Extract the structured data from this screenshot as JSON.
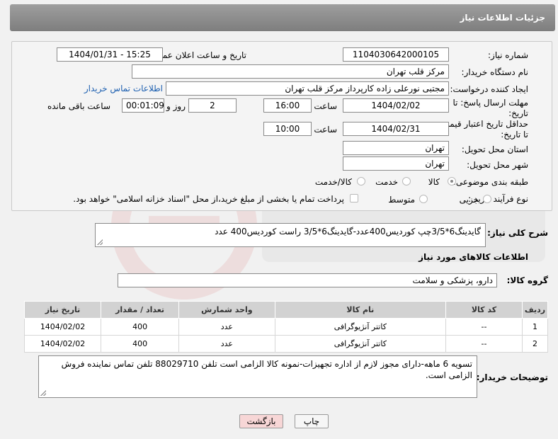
{
  "header": {
    "title": "جزئیات اطلاعات نیاز"
  },
  "form": {
    "need_number": {
      "label": "شماره نیاز:",
      "value": "1104030642000105"
    },
    "announce_datetime": {
      "label": "تاریخ و ساعت اعلان عمومی:",
      "value": "1404/01/31 - 15:25"
    },
    "buyer_org": {
      "label": "نام دستگاه خریدار:",
      "value": "مرکز قلب تهران"
    },
    "requester": {
      "label": "ایجاد کننده درخواست:",
      "value": "مجتبی نورعلی زاده کارپرداز مرکز قلب تهران",
      "contact_link": "اطلاعات تماس خریدار"
    },
    "deadline": {
      "label_line1": "مهلت ارسال پاسخ: تا",
      "label_line2": "تاریخ:",
      "date": "1404/02/02",
      "time_label": "ساعت",
      "time": "16:00",
      "days": "2",
      "days_label": "روز و",
      "remaining": "00:01:09",
      "remaining_label": "ساعت باقی مانده"
    },
    "price_validity": {
      "label_line1": "حداقل تاریخ اعتبار قیمت:",
      "label_line2": "تا تاریخ:",
      "date": "1404/02/31",
      "time_label": "ساعت",
      "time": "10:00"
    },
    "province": {
      "label": "استان محل تحویل:",
      "value": "تهران"
    },
    "city": {
      "label": "شهر محل تحویل:",
      "value": "تهران"
    },
    "category": {
      "label": "طبقه بندی موضوعی:",
      "options": [
        "کالا",
        "خدمت",
        "کالا/خدمت"
      ],
      "selected": "کالا"
    },
    "purchase_type": {
      "label": "نوع فرآیند خرید :",
      "options": [
        "جزیی",
        "متوسط"
      ],
      "note": "پرداخت تمام یا بخشی از مبلغ خرید،از محل \"اسناد خزانه اسلامی\" خواهد بود."
    }
  },
  "summary": {
    "label": "شرح کلی نیاز:",
    "value": "گایدینگ6*3/5چپ کوردیس400عدد-گایدینگ6*3/5 راست کوردیس400 عدد"
  },
  "goods_section": {
    "title": "اطلاعات کالاهای مورد نیاز",
    "group_label": "گروه کالا:",
    "group_value": "دارو، پزشکی و سلامت"
  },
  "table": {
    "headers": [
      "ردیف",
      "کد کالا",
      "نام کالا",
      "واحد شمارش",
      "تعداد / مقدار",
      "تاریخ نیاز"
    ],
    "rows": [
      [
        "1",
        "--",
        "کاتتر آنژیوگرافی",
        "عدد",
        "400",
        "1404/02/02"
      ],
      [
        "2",
        "--",
        "کاتتر آنژیوگرافی",
        "عدد",
        "400",
        "1404/02/02"
      ]
    ]
  },
  "buyer_notes": {
    "label": "توضیحات خریدار:",
    "value": "تسویه 6 ماهه-دارای مجوز لازم از اداره تجهیزات-نمونه کالا الزامی است تلفن 88029710 تلفن تماس نماینده فروش الزامی است."
  },
  "buttons": {
    "print": "چاپ",
    "back": "بازگشت"
  },
  "colors": {
    "header_bg": "#8a8a8a",
    "link": "#1c5fb0",
    "back_button_bg": "#f7d6d6"
  }
}
